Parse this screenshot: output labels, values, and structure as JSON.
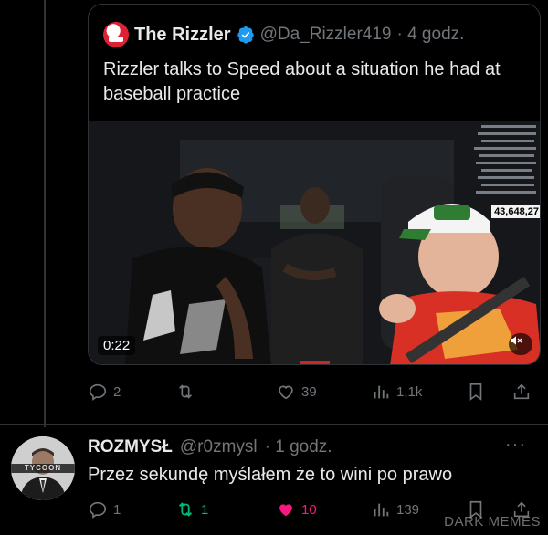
{
  "quoted_tweet": {
    "author_name": "The Rizzler",
    "handle": "@Da_Rizzler419",
    "time": "· 4 godz.",
    "text": "Rizzler talks to Speed about a situation he had at baseball practice",
    "video": {
      "duration": "0:22",
      "overlay_view_count": "43,648,27"
    }
  },
  "main_actions": {
    "replies": "2",
    "reposts": "",
    "likes": "39",
    "views": "1,1k"
  },
  "reply": {
    "author_name": "ROZMYSŁ",
    "handle": "@r0zmysl",
    "time": "· 1 godz.",
    "text": "Przez sekundę myślałem że to wini po prawo",
    "avatar_badge": "TYCOON",
    "more": "···",
    "actions": {
      "replies": "1",
      "reposts": "1",
      "likes": "10",
      "views": "139"
    }
  },
  "watermark": "DARK MEMES",
  "colors": {
    "background": "#000000",
    "text": "#e7e9ea",
    "secondary": "#71767b",
    "verified": "#1d9bf0",
    "like_active": "#f91880",
    "repost_active": "#00ba7c",
    "border": "#2f3336"
  }
}
